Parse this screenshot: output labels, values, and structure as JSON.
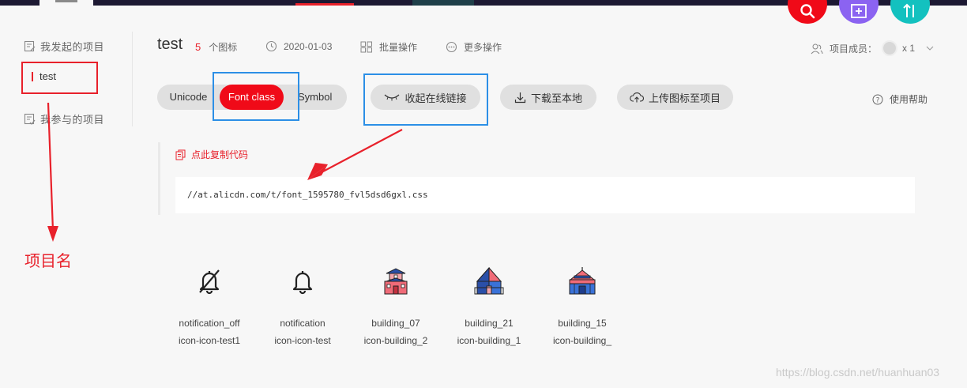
{
  "sidebar": {
    "my_projects": "我发起的项目",
    "active_project": "test",
    "joined_projects": "我参与的项目"
  },
  "header": {
    "project_title": "test",
    "icon_count": "5",
    "icon_count_unit": "个图标",
    "date": "2020-01-03",
    "batch_ops": "批量操作",
    "more_ops": "更多操作",
    "members_label": "项目成员：",
    "members_count": "x 1"
  },
  "tabs": {
    "unicode": "Unicode",
    "font_class": "Font class",
    "symbol": "Symbol",
    "active": "Font class"
  },
  "actions": {
    "collapse_link": "收起在线链接",
    "download": "下载至本地",
    "upload": "上传图标至项目",
    "help": "使用帮助"
  },
  "code": {
    "copy_label": "点此复制代码",
    "url": "//at.alicdn.com/t/font_1595780_fvl5dsd6gxl.css"
  },
  "icons": [
    {
      "name": "notification_off",
      "class": "icon-icon-test1",
      "glyph": "bell-off-icon"
    },
    {
      "name": "notification",
      "class": "icon-icon-test",
      "glyph": "bell-icon"
    },
    {
      "name": "building_07",
      "class": "icon-building_2",
      "glyph": "building-07-icon"
    },
    {
      "name": "building_21",
      "class": "icon-building_1",
      "glyph": "building-21-icon"
    },
    {
      "name": "building_15",
      "class": "icon-building_",
      "glyph": "building-15-icon"
    }
  ],
  "annotation": {
    "label": "项目名"
  },
  "watermark": "https://blog.csdn.net/huanhuan03",
  "colors": {
    "brand_red": "#f00a18",
    "annotation_blue": "#2c8fe6",
    "purple": "#8b63f1",
    "teal": "#13c1bf"
  }
}
